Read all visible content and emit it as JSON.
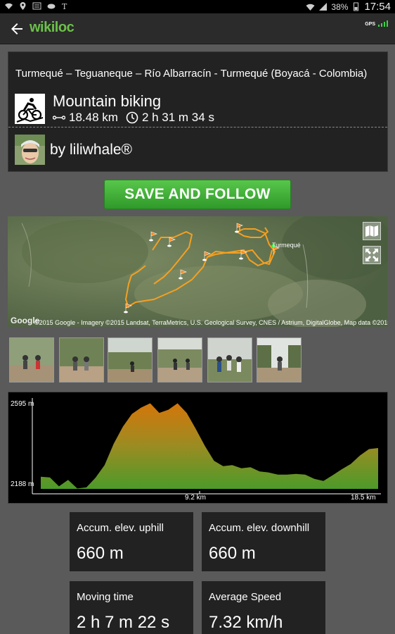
{
  "status_bar": {
    "battery": "38%",
    "time": "17:54"
  },
  "app_bar": {
    "logo": "wikiloc",
    "gps_label": "GPS"
  },
  "trail": {
    "title": "Turmequé – Teguaneque – Río Albarracín - Turmequé (Boyacá - Colombia)",
    "activity": "Mountain biking",
    "distance": "18.48 km",
    "duration": "2 h 31 m 34 s",
    "author": "by liliwhale®"
  },
  "save_button": "SAVE AND FOLLOW",
  "map": {
    "google": "Google",
    "attribution": "©2015 Google - Imagery ©2015 Landsat, TerraMetrics, U.S. Geological Survey, CNES / Astrium, DigitalGlobe, Map data ©2015 Google",
    "place": "Turmequé"
  },
  "photos": [
    "photo-1",
    "photo-2",
    "photo-3",
    "photo-4",
    "photo-5",
    "photo-6"
  ],
  "chart_data": {
    "type": "area",
    "x_unit": "km",
    "x_ticks": [
      "9.2 km",
      "18.5 km"
    ],
    "y_ticks": [
      "2595 m",
      "2188 m"
    ],
    "ylim": [
      2188,
      2595
    ],
    "xlim": [
      0,
      18.5
    ],
    "x": [
      0,
      0.5,
      1.0,
      1.5,
      2.0,
      2.5,
      3.0,
      3.5,
      4.0,
      4.5,
      5.0,
      5.5,
      6.0,
      6.5,
      7.0,
      7.5,
      8.0,
      8.5,
      9.0,
      9.5,
      10.0,
      10.5,
      11.0,
      11.5,
      12.0,
      12.5,
      13.0,
      13.5,
      14.0,
      14.5,
      15.0,
      15.5,
      16.0,
      16.5,
      17.0,
      17.5,
      18.0,
      18.5
    ],
    "y": [
      2245,
      2242,
      2200,
      2230,
      2190,
      2195,
      2240,
      2300,
      2400,
      2480,
      2540,
      2570,
      2590,
      2545,
      2560,
      2590,
      2545,
      2470,
      2390,
      2320,
      2295,
      2300,
      2285,
      2290,
      2270,
      2265,
      2255,
      2255,
      2258,
      2255,
      2235,
      2225,
      2252,
      2280,
      2305,
      2345,
      2375,
      2380
    ]
  },
  "stats": [
    {
      "label": "Accum. elev. uphill",
      "value": "660 m"
    },
    {
      "label": "Accum. elev. downhill",
      "value": "660 m"
    },
    {
      "label": "Moving time",
      "value": "2 h 7 m 22 s"
    },
    {
      "label": "Average Speed",
      "value": "7.32 km/h"
    }
  ]
}
